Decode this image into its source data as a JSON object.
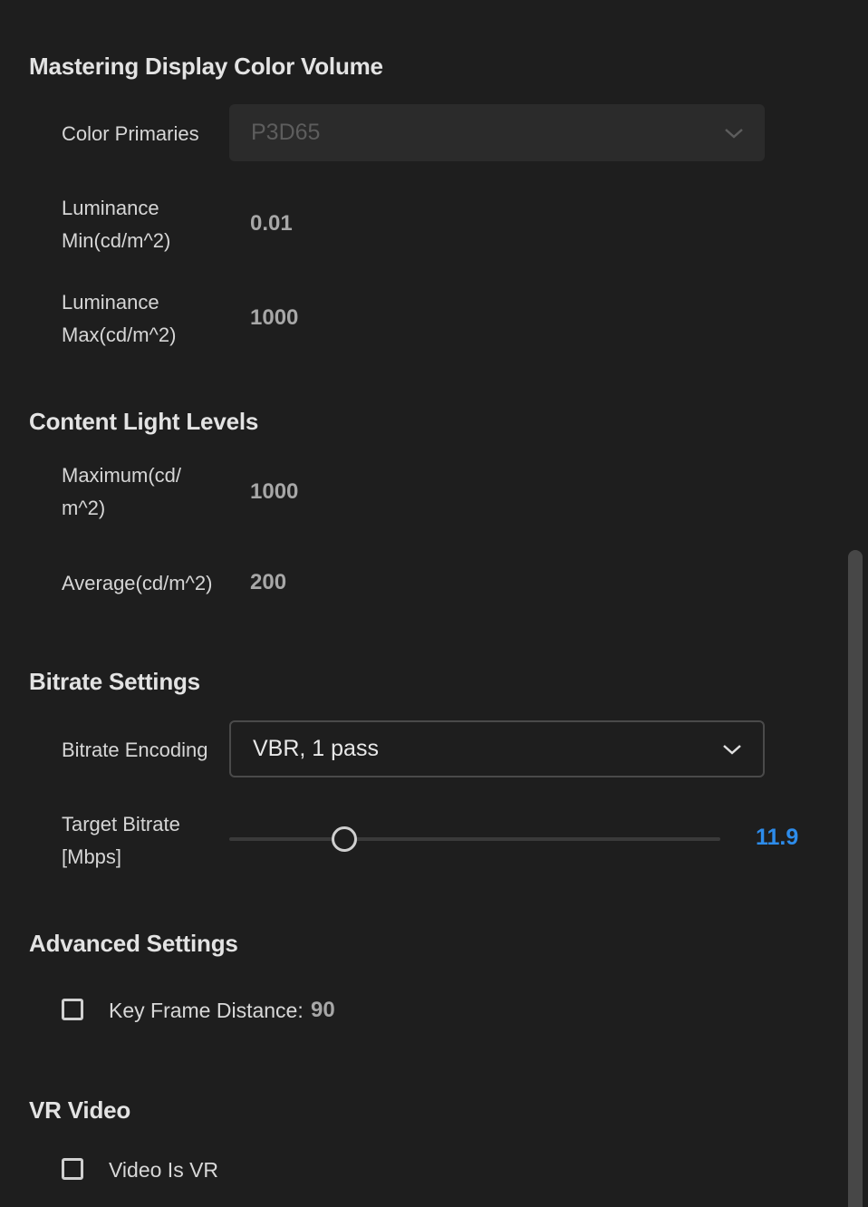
{
  "mastering": {
    "title": "Mastering Display Color Volume",
    "color_primaries_label": "Color Primaries",
    "color_primaries_value": "P3D65",
    "lum_min_label_1": "Luminance",
    "lum_min_label_2": "Min(cd/m^2)",
    "lum_min_value": "0.01",
    "lum_max_label_1": "Luminance",
    "lum_max_label_2": "Max(cd/m^2)",
    "lum_max_value": "1000"
  },
  "content_light": {
    "title": "Content Light Levels",
    "max_label_1": "Maximum(cd/",
    "max_label_2": "m^2)",
    "max_value": "1000",
    "avg_label": "Average(cd/m^2)",
    "avg_value": "200"
  },
  "bitrate": {
    "title": "Bitrate Settings",
    "encoding_label": "Bitrate Encoding",
    "encoding_value": "VBR, 1 pass",
    "target_label_1": "Target Bitrate",
    "target_label_2": "[Mbps]",
    "target_value": "11.9",
    "target_fraction": 0.235
  },
  "advanced": {
    "title": "Advanced Settings",
    "keyframe_label": "Key Frame Distance:",
    "keyframe_value": "90",
    "keyframe_checked": false
  },
  "vr": {
    "title": "VR Video",
    "vr_label": "Video Is VR",
    "vr_checked": false
  },
  "colors": {
    "accent": "#2d8ceb",
    "background": "#1e1e1e"
  }
}
